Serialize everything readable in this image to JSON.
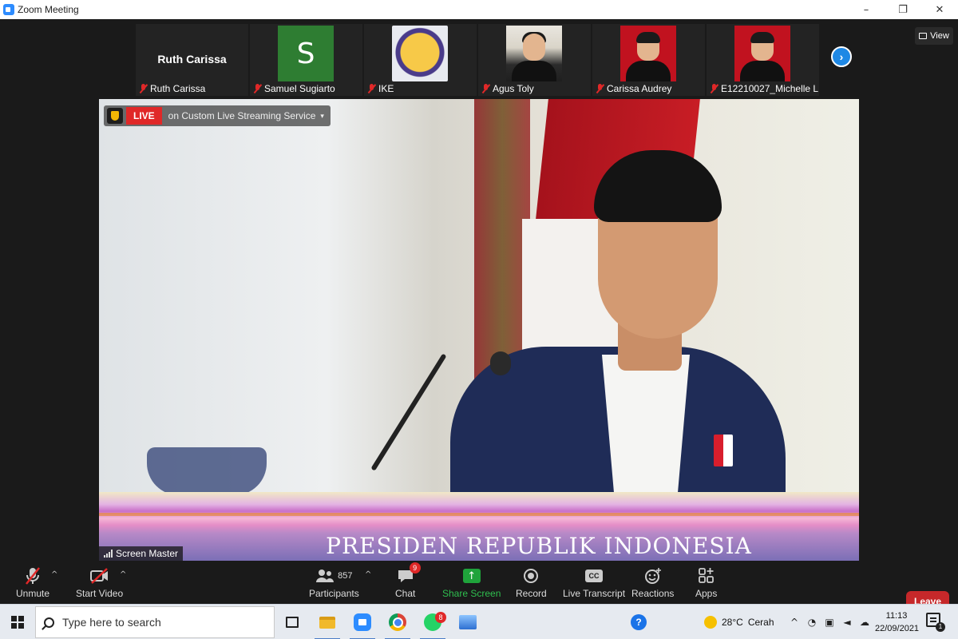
{
  "window": {
    "title": "Zoom Meeting",
    "controls": [
      "–",
      "❐",
      "✕"
    ]
  },
  "view_button": {
    "label": "View",
    "icon": "grid-icon"
  },
  "participants_strip": [
    {
      "name": "Ruth Carissa",
      "display": "Ruth Carissa",
      "video": "name-only",
      "muted": true
    },
    {
      "name": "Samuel Sugiarto",
      "display": "S",
      "video": "letter-avatar",
      "avatar_color": "#2e7d32",
      "muted": true
    },
    {
      "name": "IKE",
      "video": "photo",
      "muted": true
    },
    {
      "name": "Agus Toly",
      "video": "photo",
      "muted": true
    },
    {
      "name": "Carissa Audrey",
      "video": "photo",
      "background": "#c1121f",
      "muted": true
    },
    {
      "name": "E12210027_Michelle L...",
      "video": "photo",
      "background": "#c1121f",
      "muted": true
    }
  ],
  "strip_next_icon": "chevron-right-icon",
  "main_video": {
    "live_label": "LIVE",
    "stream_label": "on Custom Live Streaming Service",
    "stream_caret": "▾",
    "banner_text": "PRESIDEN REPUBLIK INDONESIA",
    "speaker_label": "Screen Master"
  },
  "toolbar": {
    "unmute": {
      "label": "Unmute",
      "icon": "muted-microphone-icon"
    },
    "start_video": {
      "label": "Start Video",
      "icon": "video-off-icon"
    },
    "participants": {
      "label": "Participants",
      "count": "857",
      "icon": "participants-icon"
    },
    "chat": {
      "label": "Chat",
      "badge": "9",
      "icon": "chat-icon"
    },
    "share_screen": {
      "label": "Share Screen",
      "icon": "share-screen-icon",
      "color": "#1fa33b"
    },
    "record": {
      "label": "Record",
      "icon": "record-icon"
    },
    "live_transcript": {
      "label": "Live Transcript",
      "icon": "cc-icon",
      "icon_text": "CC"
    },
    "reactions": {
      "label": "Reactions",
      "icon": "reactions-icon"
    },
    "apps": {
      "label": "Apps",
      "icon": "apps-icon"
    },
    "leave": {
      "label": "Leave",
      "color": "#c6282a"
    }
  },
  "taskbar": {
    "search_placeholder": "Type here to search",
    "apps": [
      "task-view-icon",
      "file-explorer-icon",
      "zoom-icon",
      "chrome-icon",
      "whatsapp-icon",
      "photos-icon"
    ],
    "whatsapp_badge": "8",
    "weather": {
      "temp": "28°C",
      "condition": "Cerah"
    },
    "clock": {
      "time": "11:13",
      "date": "22/09/2021"
    },
    "notification_count": "1"
  }
}
